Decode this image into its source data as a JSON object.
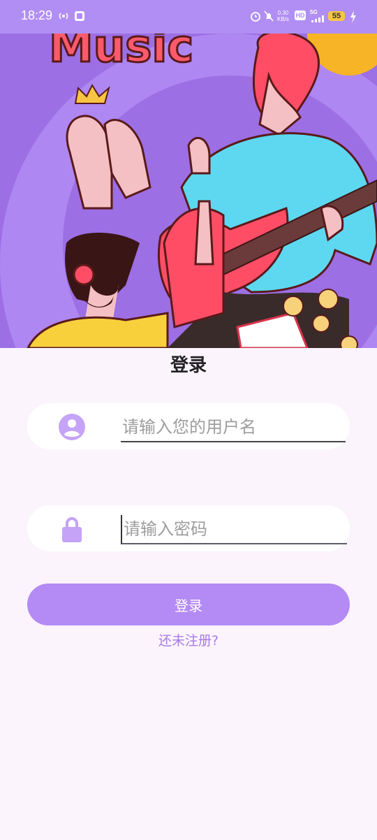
{
  "status_bar": {
    "time": "18:29",
    "net_speed_value": "0.30",
    "net_speed_unit": "KB/s",
    "hd_label": "HD",
    "signal_label": "5G",
    "battery_level": "55"
  },
  "hero": {
    "art_text": "Music"
  },
  "login": {
    "title": "登录",
    "username_placeholder": "请输入您的用户名",
    "password_placeholder": "请输入密码",
    "submit_label": "登录",
    "register_link": "还未注册?"
  },
  "colors": {
    "accent": "#b48af4",
    "background": "#fcf4fd",
    "icon": "#c5a3f7"
  }
}
